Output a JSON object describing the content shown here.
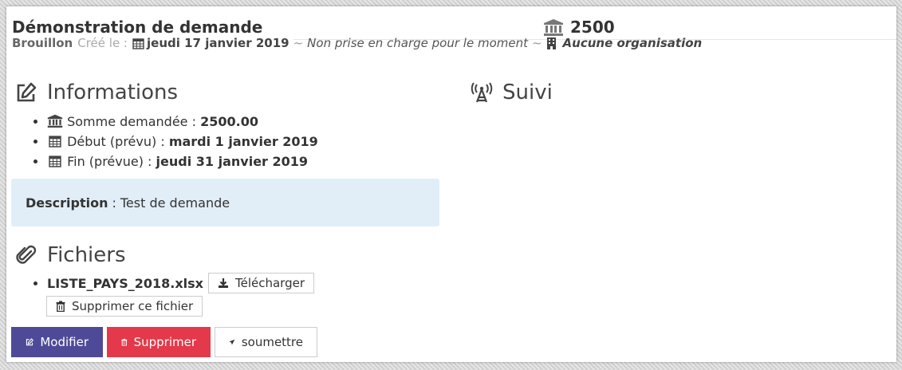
{
  "request": {
    "title": "Démonstration de demande",
    "amount": "2500",
    "status": "Brouillon",
    "created_label": "Créé le :",
    "created_date": "jeudi 17 janvier 2019",
    "separator": "~",
    "handling_note": "Non prise en charge pour le moment",
    "organization": "Aucune organisation"
  },
  "info": {
    "heading": "Informations",
    "items": [
      {
        "label": "Somme demandée :",
        "value": "2500.00",
        "icon": "bank-icon"
      },
      {
        "label": "Début (prévu) :",
        "value": "mardi 1 janvier 2019",
        "icon": "calendar-icon"
      },
      {
        "label": "Fin (prévue) :",
        "value": "jeudi 31 janvier 2019",
        "icon": "calendar-icon"
      }
    ],
    "description_label": "Description",
    "description_sep": ":",
    "description_text": "Test de demande"
  },
  "tracking": {
    "heading": "Suivi",
    "icon": "antenna-icon"
  },
  "files": {
    "heading": "Fichiers",
    "items": [
      {
        "name": "LISTE_PAYS_2018.xlsx",
        "download_label": "Télécharger",
        "delete_label": "Supprimer ce fichier"
      }
    ]
  },
  "actions": {
    "edit_label": "Modifier",
    "delete_label": "Supprimer",
    "submit_label": "soumettre"
  },
  "colors": {
    "edit": "#4f4a98",
    "delete": "#e3394a",
    "description_bg": "#e1eef8"
  }
}
